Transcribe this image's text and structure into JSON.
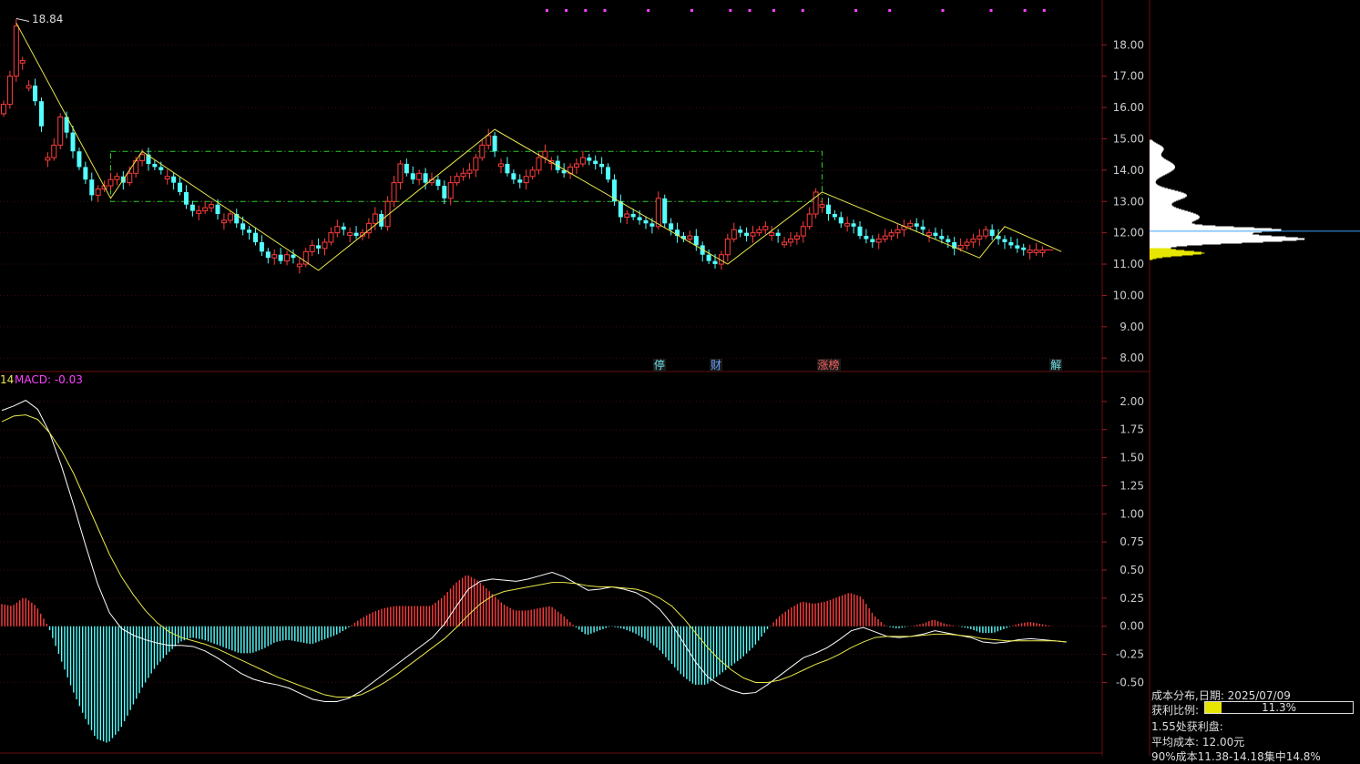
{
  "chart_data": [
    {
      "type": "candlestick",
      "ylim": [
        7.6,
        19.2
      ],
      "y_ticks": [
        "18.00",
        "17.00",
        "16.00",
        "15.00",
        "14.00",
        "13.00",
        "12.00",
        "11.00",
        "10.00",
        "9.00",
        "8.00"
      ],
      "annotations": {
        "high_label": "18.84"
      },
      "events": [
        {
          "label": "停",
          "index": 104,
          "color": "#6ee0e8"
        },
        {
          "label": "财",
          "index": 113,
          "color": "#6aa0ff"
        },
        {
          "label": "涨榜",
          "index": 130,
          "color": "#ff6060"
        },
        {
          "label": "解",
          "index": 167,
          "color": "#6ee0e8"
        }
      ],
      "zigzag": [
        [
          2,
          18.7
        ],
        [
          17,
          13.1
        ],
        [
          22,
          14.6
        ],
        [
          50,
          10.8
        ],
        [
          78,
          15.3
        ],
        [
          115,
          11.0
        ],
        [
          130,
          13.3
        ],
        [
          155,
          11.2
        ],
        [
          159,
          12.2
        ],
        [
          168,
          11.4
        ]
      ],
      "box": {
        "start": 17,
        "end": 130,
        "top": 14.6,
        "bottom": 13.0
      },
      "close": [
        16.1,
        17.0,
        18.6,
        17.5,
        16.7,
        16.2,
        15.4,
        14.4,
        14.8,
        15.7,
        15.2,
        14.6,
        14.1,
        13.7,
        13.2,
        13.4,
        13.5,
        13.7,
        13.8,
        13.6,
        13.9,
        14.3,
        14.5,
        14.2,
        14.1,
        14.0,
        13.8,
        13.6,
        13.3,
        12.9,
        12.7,
        12.7,
        12.8,
        12.9,
        12.6,
        12.4,
        12.6,
        12.3,
        12.1,
        12.0,
        11.7,
        11.4,
        11.2,
        11.3,
        11.1,
        11.3,
        11.2,
        11.0,
        11.4,
        11.6,
        11.5,
        11.7,
        12.0,
        12.2,
        12.1,
        12.0,
        11.9,
        12.0,
        12.3,
        12.6,
        12.2,
        13.0,
        13.6,
        14.2,
        13.9,
        13.7,
        13.9,
        13.6,
        13.7,
        13.5,
        13.1,
        13.6,
        13.8,
        13.9,
        14.0,
        14.4,
        14.8,
        15.1,
        14.6,
        14.2,
        13.9,
        13.7,
        13.6,
        13.8,
        14.0,
        14.4,
        14.6,
        14.3,
        14.0,
        13.9,
        14.1,
        14.2,
        14.4,
        14.3,
        14.2,
        14.1,
        13.7,
        13.0,
        12.5,
        12.6,
        12.5,
        12.4,
        12.3,
        12.2,
        13.1,
        12.3,
        12.1,
        11.9,
        11.8,
        11.9,
        11.6,
        11.3,
        11.1,
        11.0,
        11.3,
        11.8,
        12.1,
        12.0,
        11.9,
        12.0,
        12.1,
        12.2,
        12.0,
        11.9,
        11.7,
        11.8,
        11.9,
        12.2,
        12.6,
        13.3,
        12.9,
        12.6,
        12.5,
        12.3,
        12.3,
        12.2,
        11.9,
        11.8,
        11.7,
        11.8,
        11.9,
        12.0,
        12.1,
        12.2,
        12.3,
        12.2,
        12.1,
        12.0,
        11.9,
        11.8,
        11.7,
        11.5,
        11.6,
        11.7,
        11.8,
        11.9,
        12.1,
        11.9,
        11.8,
        11.7,
        11.6,
        11.5,
        11.45,
        11.45,
        11.45,
        11.45
      ],
      "up_markers": [
        3,
        4,
        7,
        15,
        20,
        26,
        33,
        35,
        47,
        49,
        55,
        58,
        61,
        62,
        68,
        73,
        76,
        79,
        84,
        87,
        90,
        99,
        104,
        116,
        119,
        122,
        124,
        128,
        130,
        143,
        147,
        156,
        167
      ]
    },
    {
      "type": "macd",
      "label": "MACD: -0.03",
      "short_label": "14",
      "ylim": [
        -1.12,
        2.25
      ],
      "y_ticks": [
        "2.00",
        "1.75",
        "1.50",
        "1.25",
        "1.00",
        "0.75",
        "0.50",
        "0.25",
        "0.00",
        "-0.25",
        "-0.50"
      ],
      "dif": [
        1.92,
        1.96,
        2.01,
        1.93,
        1.72,
        1.42,
        1.08,
        0.72,
        0.38,
        0.12,
        -0.02,
        -0.08,
        -0.12,
        -0.15,
        -0.17,
        -0.17,
        -0.18,
        -0.22,
        -0.28,
        -0.35,
        -0.42,
        -0.47,
        -0.5,
        -0.52,
        -0.55,
        -0.6,
        -0.65,
        -0.67,
        -0.67,
        -0.64,
        -0.58,
        -0.5,
        -0.42,
        -0.34,
        -0.26,
        -0.18,
        -0.1,
        0.02,
        0.18,
        0.33,
        0.4,
        0.42,
        0.41,
        0.4,
        0.42,
        0.45,
        0.48,
        0.44,
        0.38,
        0.32,
        0.33,
        0.35,
        0.33,
        0.3,
        0.24,
        0.15,
        0.02,
        -0.15,
        -0.32,
        -0.45,
        -0.52,
        -0.57,
        -0.6,
        -0.59,
        -0.52,
        -0.44,
        -0.36,
        -0.28,
        -0.24,
        -0.19,
        -0.12,
        -0.04,
        -0.01,
        -0.05,
        -0.09,
        -0.1,
        -0.09,
        -0.07,
        -0.04,
        -0.06,
        -0.08,
        -0.1,
        -0.14,
        -0.15,
        -0.14,
        -0.12,
        -0.11,
        -0.12,
        -0.13,
        -0.14
      ],
      "dea": [
        1.82,
        1.87,
        1.88,
        1.84,
        1.72,
        1.56,
        1.36,
        1.12,
        0.88,
        0.64,
        0.44,
        0.28,
        0.14,
        0.03,
        -0.05,
        -0.1,
        -0.13,
        -0.16,
        -0.2,
        -0.25,
        -0.3,
        -0.35,
        -0.4,
        -0.45,
        -0.49,
        -0.53,
        -0.57,
        -0.61,
        -0.63,
        -0.63,
        -0.61,
        -0.56,
        -0.5,
        -0.43,
        -0.35,
        -0.27,
        -0.19,
        -0.11,
        -0.01,
        0.1,
        0.2,
        0.27,
        0.31,
        0.33,
        0.35,
        0.37,
        0.39,
        0.39,
        0.38,
        0.36,
        0.35,
        0.35,
        0.34,
        0.33,
        0.3,
        0.25,
        0.18,
        0.07,
        -0.06,
        -0.19,
        -0.3,
        -0.39,
        -0.46,
        -0.5,
        -0.5,
        -0.48,
        -0.44,
        -0.39,
        -0.34,
        -0.3,
        -0.25,
        -0.19,
        -0.14,
        -0.1,
        -0.09,
        -0.09,
        -0.09,
        -0.08,
        -0.07,
        -0.07,
        -0.08,
        -0.09,
        -0.11,
        -0.12,
        -0.13,
        -0.13,
        -0.13,
        -0.13,
        -0.13,
        -0.14
      ]
    }
  ],
  "cost_panel": {
    "title": "成本分布,日期: 2025/07/09",
    "profit_label": "获利比例:",
    "profit_value": "11.3%",
    "profit_ratio": 0.113,
    "line1": "1.55处获利盘:",
    "line2": "平均成本: 12.00元",
    "line3": "90%成本11.38-14.18集中14.8%"
  },
  "colors": {
    "up": "#ff3d3d",
    "down": "#54ffff",
    "zigzag": "#e8e84a",
    "box": "#2ecc2e",
    "dif": "#ffffff",
    "dea": "#e8e84a",
    "grid": "#3a0a0a",
    "magenta": "#ff40ff",
    "profile_hot": "#e6e600",
    "profile": "#ffffff",
    "current_line": "#3aa0ff"
  }
}
